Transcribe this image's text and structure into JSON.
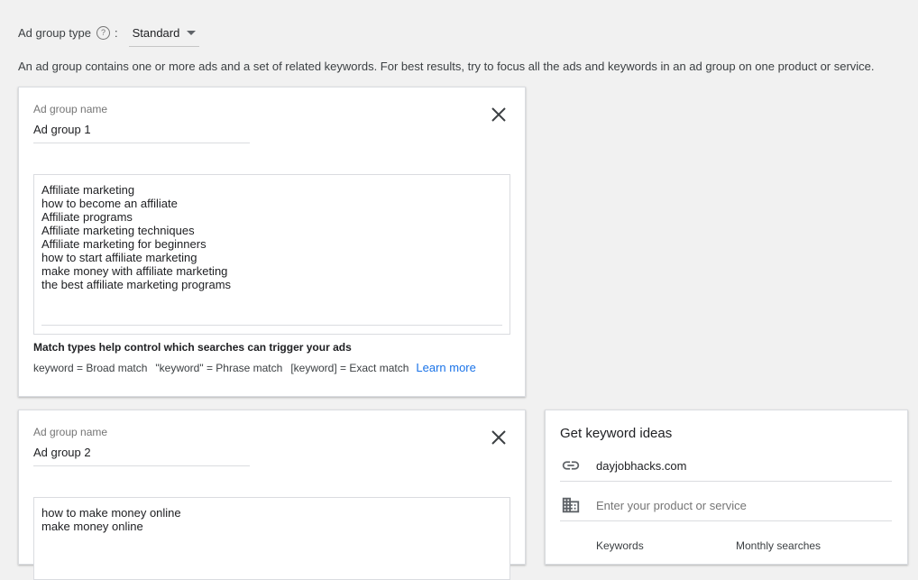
{
  "ad_group_type": {
    "label": "Ad group type",
    "help_glyph": "?",
    "colon": ":",
    "selected": "Standard"
  },
  "description": "An ad group contains one or more ads and a set of related keywords. For best results, try to focus all the ads and keywords in an ad group on one product or service.",
  "ad_groups": [
    {
      "name_label": "Ad group name",
      "name_value": "Ad group 1",
      "keywords": [
        "Affiliate marketing",
        "how to become an affiliate",
        "Affiliate programs",
        "Affiliate marketing techniques",
        "Affiliate marketing for beginners",
        "how to start affiliate marketing",
        "make money with affiliate marketing",
        "the best affiliate marketing programs"
      ],
      "match_title": "Match types help control which searches can trigger your ads",
      "match_broad": "keyword = Broad match",
      "match_phrase": "\"keyword\" = Phrase match",
      "match_exact": "[keyword] = Exact match",
      "learn_more": "Learn more"
    },
    {
      "name_label": "Ad group name",
      "name_value": "Ad group 2",
      "keywords": [
        "how to make money online",
        "make money online"
      ]
    }
  ],
  "keyword_ideas": {
    "title": "Get keyword ideas",
    "website": "dayjobhacks.com",
    "product_placeholder": "Enter your product or service",
    "col_keywords": "Keywords",
    "col_monthly": "Monthly searches"
  },
  "icons": {
    "close": "close-icon",
    "link": "link-icon",
    "building": "building-icon",
    "help": "help-icon",
    "dropdown": "chevron-down-icon"
  },
  "colors": {
    "link": "#1a73e8",
    "background": "#f1f1f1"
  }
}
